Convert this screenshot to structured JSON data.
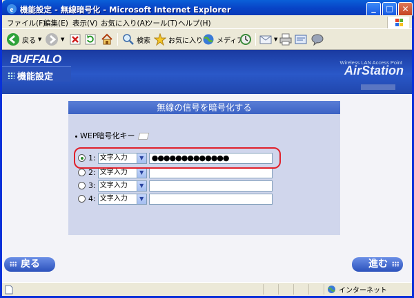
{
  "window": {
    "title": "機能設定 - 無線暗号化 - Microsoft Internet Explorer",
    "minimize": "_",
    "maximize": "□",
    "close": "✕"
  },
  "menubar": {
    "items": [
      "ファイル(F)",
      "編集(E)",
      "表示(V)",
      "お気に入り(A)",
      "ツール(T)",
      "ヘルプ(H)"
    ]
  },
  "toolbar": {
    "back_label": "戻る",
    "search_label": "検索",
    "favorites_label": "お気に入り",
    "media_label": "メディア"
  },
  "header": {
    "logo": "BUFFALO",
    "section_title": "機能設定",
    "product_tagline": "Wireless LAN Access Point",
    "product_name": "AirStation"
  },
  "panel": {
    "title": "無線の信号を暗号化する",
    "wep_label": "WEP暗号化キー",
    "keys": [
      {
        "label": "1:",
        "mode": "文字入力",
        "value": "●●●●●●●●●●●●●",
        "selected": true
      },
      {
        "label": "2:",
        "mode": "文字入力",
        "value": "",
        "selected": false
      },
      {
        "label": "3:",
        "mode": "文字入力",
        "value": "",
        "selected": false
      },
      {
        "label": "4:",
        "mode": "文字入力",
        "value": "",
        "selected": false
      }
    ]
  },
  "nav": {
    "back_label": "戻る",
    "next_label": "進む"
  },
  "statusbar": {
    "zone": "インターネット"
  },
  "colors": {
    "titlebar": "#0843c6",
    "header": "#2046ac",
    "panel": "#d0d6ec",
    "highlight": "#e0202a"
  }
}
